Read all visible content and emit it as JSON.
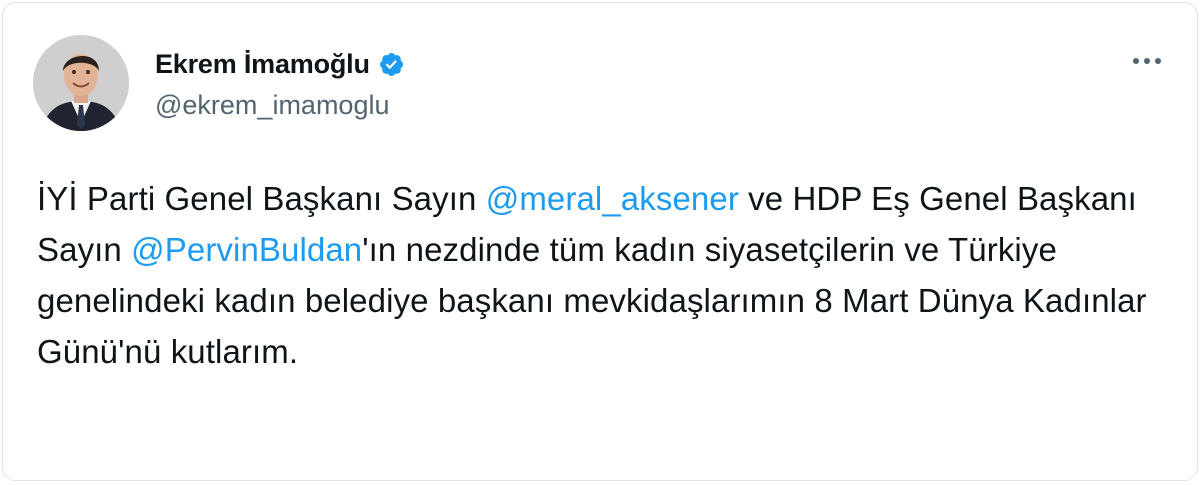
{
  "user": {
    "display_name": "Ekrem İmamoğlu",
    "handle": "@ekrem_imamoglu",
    "verified_icon": "verified-badge-icon",
    "avatar_icon": "profile-photo"
  },
  "menu": {
    "more_icon": "more-options-icon"
  },
  "tweet": {
    "t1": "İYİ Parti Genel Başkanı Sayın ",
    "mention1": "@meral_aksener",
    "t2": " ve HDP Eş Genel Başkanı Sayın ",
    "mention2": "@PervinBuldan",
    "t3": "'ın nezdinde tüm kadın siyasetçilerin ve Türkiye genelindeki kadın belediye başkanı mevkidaşlarımın 8 Mart Dünya Kadınlar Günü'nü kutlarım."
  },
  "colors": {
    "accent": "#1d9bf0",
    "text": "#0f1419",
    "secondary": "#536471"
  }
}
